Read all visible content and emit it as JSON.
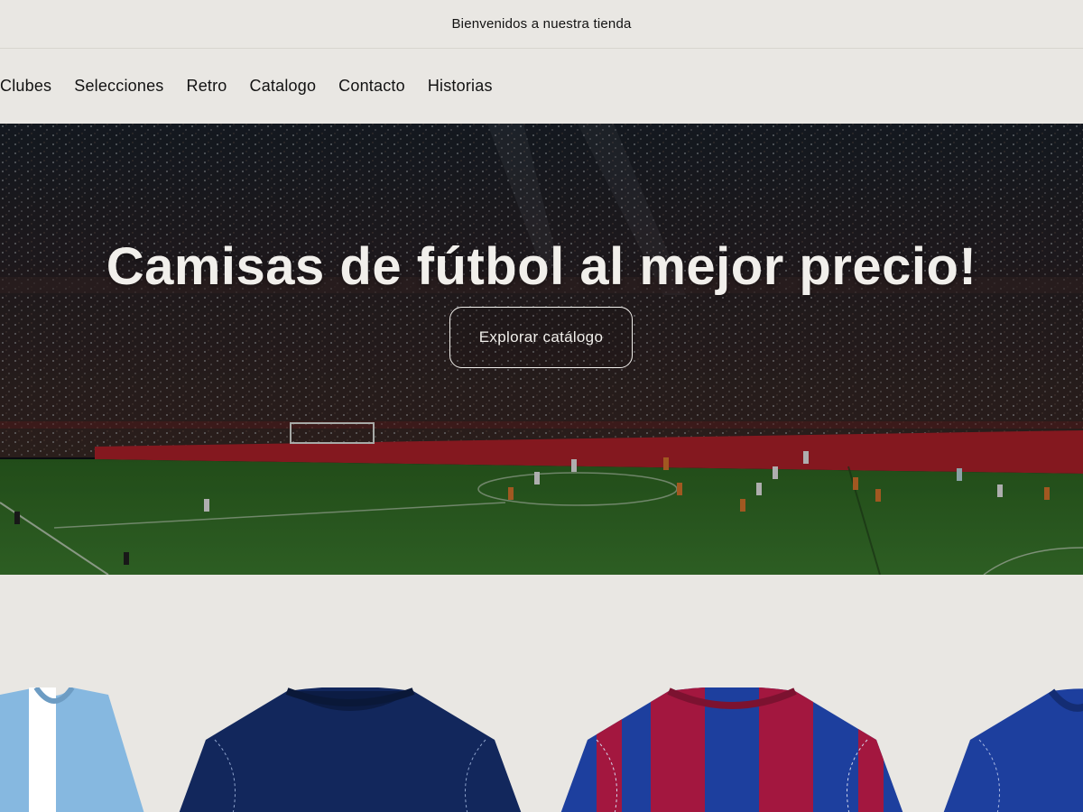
{
  "announcement": {
    "text": "Bienvenidos a nuestra tienda"
  },
  "nav": {
    "items": [
      "Clubes",
      "Selecciones",
      "Retro",
      "Catalogo",
      "Contacto",
      "Historias"
    ]
  },
  "hero": {
    "title": "Camisas de fútbol al mejor precio!",
    "button_label": "Explorar catálogo"
  },
  "colors": {
    "page_bg": "#e9e7e3",
    "text": "#121212",
    "hero_text": "#f1efeb",
    "pitch": "#3a7a2c",
    "shirt_sky": "#86b8e0",
    "shirt_navy": "#0f2557",
    "shirt_blue": "#1d3f9e",
    "shirt_claret": "#a3173f"
  },
  "products": {
    "items": [
      {
        "name": "sky-stripes-jersey",
        "icon": "shirt-icon"
      },
      {
        "name": "navy-jersey",
        "icon": "shirt-icon"
      },
      {
        "name": "blue-claret-stripes-jersey",
        "icon": "shirt-icon"
      },
      {
        "name": "royal-blue-jersey",
        "icon": "shirt-icon"
      }
    ]
  }
}
